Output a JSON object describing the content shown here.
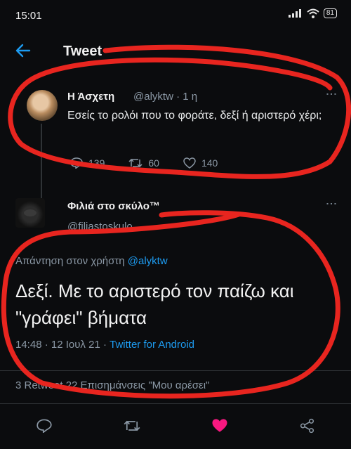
{
  "status_bar": {
    "time": "15:01",
    "battery": "81"
  },
  "header": {
    "title": "Tweet"
  },
  "tweet1": {
    "name": "Η Άσχετη",
    "handle": "@alyktw · 1 η",
    "text": "Εσείς το ρολόι που το φοράτε, δεξί ή αριστερό χέρι;",
    "replies": "139",
    "retweets": "60",
    "likes": "140"
  },
  "tweet2": {
    "name": "Φιλιά στο σκύλο™",
    "handle": "@filiastoskulo",
    "reply_prefix": "Απάντηση στον χρήστη",
    "reply_mention": "@alyktw",
    "text": "Δεξί. Με το αριστερό τον παίζω και \"γράφει\" βήματα",
    "timestamp": "14:48 · 12 Ιουλ 21 · ",
    "source": "Twitter for Android",
    "stats": "3 Retweet  22 Επισημάνσεις \"Μου αρέσει\""
  },
  "colors": {
    "accent": "#1d9bf0",
    "like": "#f91880",
    "annotation": "#e8251f"
  },
  "icons": {
    "back": "arrow-left-icon",
    "reply": "reply-icon",
    "retweet": "retweet-icon",
    "like": "heart-icon",
    "share": "share-icon",
    "more": "more-icon"
  }
}
